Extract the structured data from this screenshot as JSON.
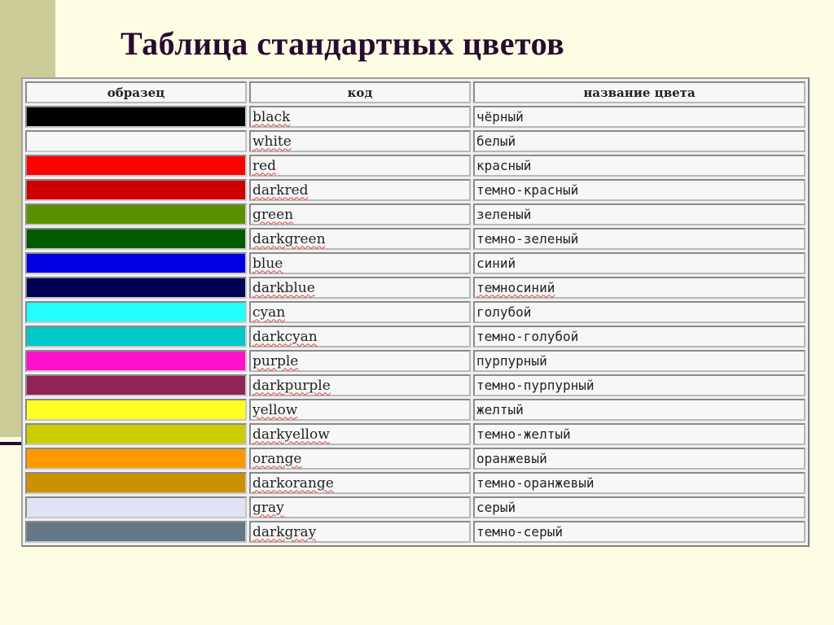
{
  "title": "Таблица стандартных цветов",
  "table": {
    "headers": [
      "образец",
      "код",
      "название цвета"
    ],
    "rows": [
      {
        "swatch": "#000000",
        "code": "black",
        "name": "чёрный"
      },
      {
        "swatch": "#f7f7f7",
        "code": "white",
        "name": "белый"
      },
      {
        "swatch": "#ff0000",
        "code": "red",
        "name": "красный"
      },
      {
        "swatch": "#cc0000",
        "code": "darkred",
        "name": "темно-красный"
      },
      {
        "swatch": "#5a9000",
        "code": "green",
        "name": "зеленый"
      },
      {
        "swatch": "#005a00",
        "code": "darkgreen",
        "name": "темно-зеленый"
      },
      {
        "swatch": "#0000e0",
        "code": "blue",
        "name": "синий"
      },
      {
        "swatch": "#000055",
        "code": "darkblue",
        "name": "темносиний",
        "spell": true
      },
      {
        "swatch": "#22ffff",
        "code": "cyan",
        "name": "голубой"
      },
      {
        "swatch": "#00c8c8",
        "code": "darkcyan",
        "name": "темно-голубой"
      },
      {
        "swatch": "#ff11cc",
        "code": "purple",
        "name": "пурпурный"
      },
      {
        "swatch": "#932256",
        "code": "darkpurple",
        "name": "темно-пурпурный"
      },
      {
        "swatch": "#ffff22",
        "code": "yellow",
        "name": "желтый"
      },
      {
        "swatch": "#cccc00",
        "code": "darkyellow",
        "name": "темно-желтый"
      },
      {
        "swatch": "#ff9900",
        "code": "orange",
        "name": "оранжевый"
      },
      {
        "swatch": "#cc9000",
        "code": "darkorange",
        "name": "темно-оранжевый"
      },
      {
        "swatch": "#e2e2f6",
        "code": "gray",
        "name": "серый"
      },
      {
        "swatch": "#667788",
        "code": "darkgray",
        "name": "темно-серый"
      }
    ]
  }
}
